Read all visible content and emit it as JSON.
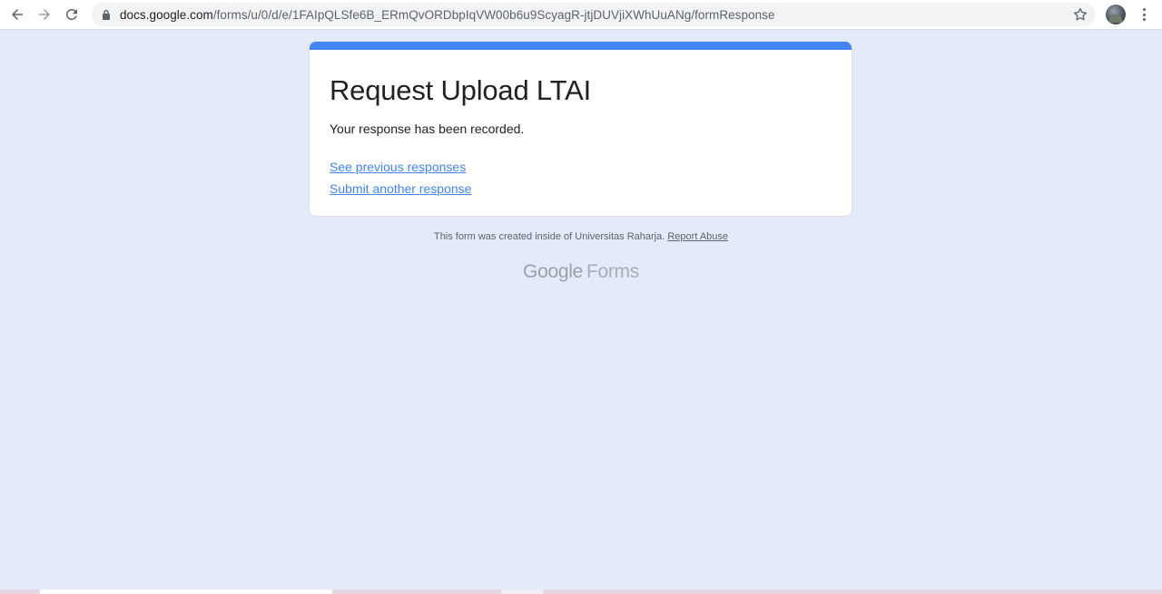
{
  "browser": {
    "url_host": "docs.google.com",
    "url_path": "/forms/u/0/d/e/1FAIpQLSfe6B_ERmQvORDbpIqVW00b6u9ScyagR-jtjDUVjiXWhUuANg/formResponse",
    "icons": {
      "back": "arrow-left-icon",
      "forward": "arrow-right-icon",
      "reload": "reload-icon",
      "lock": "lock-icon",
      "bookmark": "star-icon",
      "menu": "more-vert-icon"
    }
  },
  "form": {
    "accent_color": "#4285f4",
    "title": "Request Upload LTAI",
    "confirmation": "Your response has been recorded.",
    "links": {
      "previous": "See previous responses",
      "another": "Submit another response"
    }
  },
  "footer": {
    "note": "This form was created inside of Universitas Raharja.",
    "report": "Report Abuse",
    "brand_google": "Google",
    "brand_forms": "Forms"
  },
  "colors": {
    "page_background": "#e3ebfa",
    "link": "#4285f4"
  }
}
